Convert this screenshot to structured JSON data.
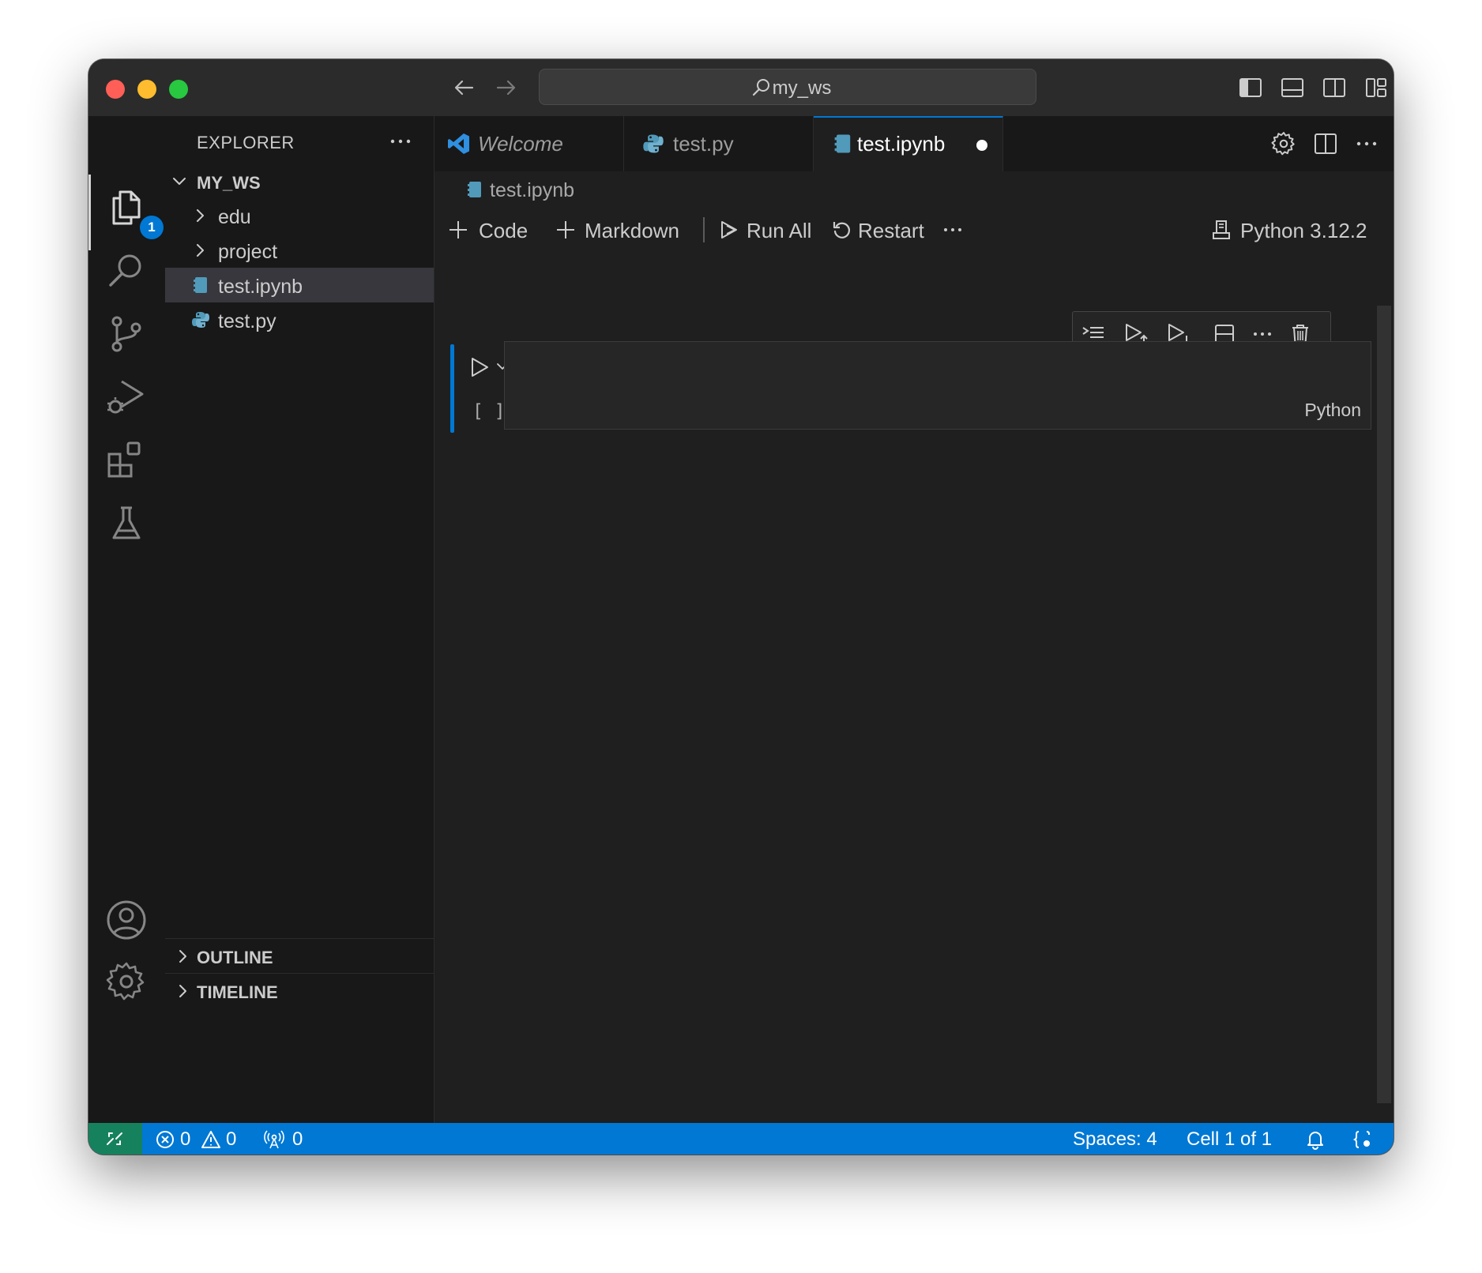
{
  "window": {
    "search_text": "my_ws"
  },
  "activity": {
    "explorer_badge": "1"
  },
  "sidebar": {
    "title": "EXPLORER",
    "workspace": "MY_WS",
    "items": [
      {
        "label": "edu",
        "type": "folder"
      },
      {
        "label": "project",
        "type": "folder"
      },
      {
        "label": "test.ipynb",
        "type": "notebook",
        "selected": true
      },
      {
        "label": "test.py",
        "type": "python"
      }
    ],
    "sections": [
      {
        "label": "OUTLINE"
      },
      {
        "label": "TIMELINE"
      }
    ]
  },
  "tabs": [
    {
      "label": "Welcome",
      "icon": "vscode-icon"
    },
    {
      "label": "test.py",
      "icon": "python-icon"
    },
    {
      "label": "test.ipynb",
      "icon": "notebook-icon",
      "active": true,
      "dirty": true
    }
  ],
  "breadcrumb": {
    "label": "test.ipynb"
  },
  "toolbar": {
    "code": "Code",
    "markdown": "Markdown",
    "run_all": "Run All",
    "restart": "Restart",
    "kernel": "Python 3.12.2"
  },
  "cell": {
    "execution_count": "[ ]",
    "language": "Python"
  },
  "statusbar": {
    "errors": "0",
    "warnings": "0",
    "ports": "0",
    "spaces": "Spaces: 4",
    "cell_position": "Cell 1 of 1"
  },
  "colors": {
    "accent": "#0078d4",
    "remote": "#16825d",
    "close": "#ff5f57",
    "minimize": "#febc2e",
    "zoom": "#28c840"
  }
}
